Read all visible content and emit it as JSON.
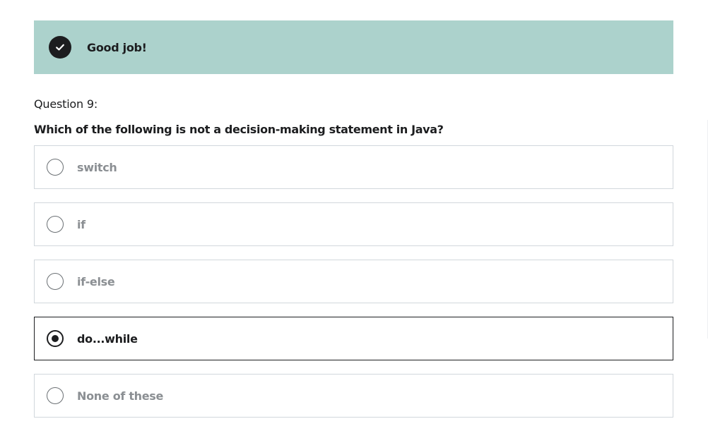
{
  "banner": {
    "icon": "check-circle-icon",
    "text": "Good job!",
    "background_color": "#acd2cc"
  },
  "question": {
    "label": "Question 9:",
    "text": "Which of the following is not a decision-making statement in Java?"
  },
  "answers": [
    {
      "label": "switch",
      "selected": false
    },
    {
      "label": "if",
      "selected": false
    },
    {
      "label": "if-else",
      "selected": false
    },
    {
      "label": "do...while",
      "selected": true
    },
    {
      "label": "None of these",
      "selected": false
    }
  ]
}
